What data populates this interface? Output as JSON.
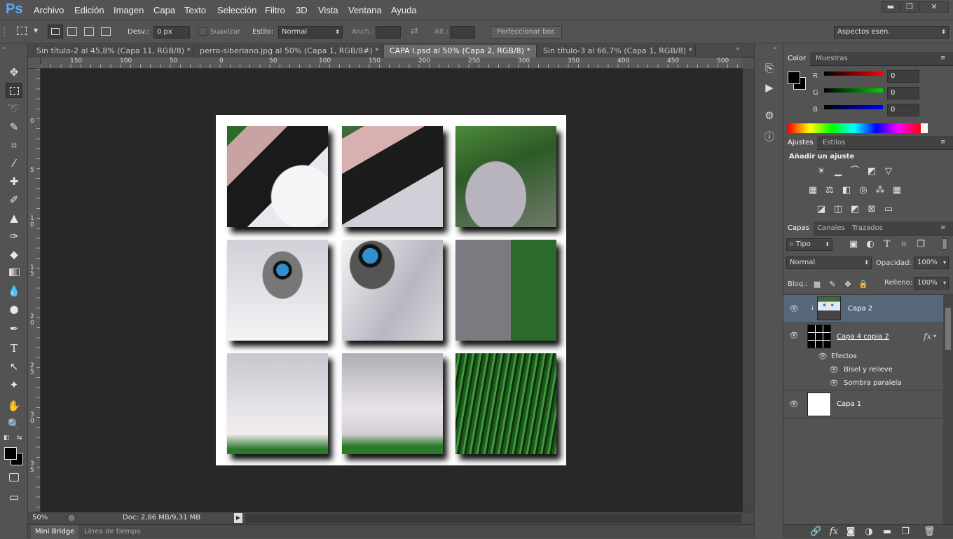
{
  "app": {
    "logo": "Ps"
  },
  "menu": [
    "Archivo",
    "Edición",
    "Imagen",
    "Capa",
    "Texto",
    "Selección",
    "Filtro",
    "3D",
    "Vista",
    "Ventana",
    "Ayuda"
  ],
  "window_controls": {
    "minimize": "▬",
    "restore": "❐",
    "close": "✕"
  },
  "options": {
    "feather_label": "Desv.:",
    "feather_value": "0 px",
    "antialias_label": "Suavizar",
    "style_label": "Estilo:",
    "style_value": "Normal",
    "width_label": "Anch.:",
    "height_label": "Alt.:",
    "refine_button": "Perfeccionar bor.",
    "workspace": "Aspectos esen."
  },
  "tabs": [
    {
      "label": "Sin título-2 al 45,8% (Capa 11, RGB/8) *",
      "active": false
    },
    {
      "label": "perro-siberiano.jpg al 50% (Capa 1, RGB/8#) *",
      "active": false
    },
    {
      "label": "CAPA I.psd al 50% (Capa 2, RGB/8) *",
      "active": true
    },
    {
      "label": "Sin título-3 al 66,7% (Capa 1, RGB/8) *",
      "active": false
    }
  ],
  "ruler_h": [
    "150",
    "100",
    "50",
    "0",
    "50",
    "100",
    "150",
    "200",
    "250",
    "300",
    "350",
    "400",
    "450",
    "500"
  ],
  "ruler_v": [
    "0",
    "5",
    "1 0",
    "1 5",
    "2 0",
    "2 5",
    "3 0",
    "3 5"
  ],
  "status": {
    "zoom": "50%",
    "doc": "Doc: 2,86 MB/9,31 MB"
  },
  "bottom_tabs": [
    "Mini Bridge",
    "Línea de tiempo"
  ],
  "color_panel": {
    "tabs": [
      "Color",
      "Muestras"
    ],
    "channels": [
      {
        "label": "R",
        "value": "0"
      },
      {
        "label": "G",
        "value": "0"
      },
      {
        "label": "B",
        "value": "0"
      }
    ],
    "colors": {
      "red": "#ff0000",
      "green": "#00c000",
      "blue": "#0000ff"
    }
  },
  "adjust_panel": {
    "tabs": [
      "Ajustes",
      "Estilos"
    ],
    "title": "Añadir un ajuste"
  },
  "layers_panel": {
    "tabs": [
      "Capas",
      "Canales",
      "Trazados"
    ],
    "filter": "Tipo",
    "blend": "Normal",
    "opacity_label": "Opacidad:",
    "opacity": "100%",
    "lock_label": "Bloq.:",
    "fill_label": "Relleno:",
    "fill": "100%",
    "layers": [
      {
        "name": "Capa 2",
        "selected": true
      },
      {
        "name": "Capa 4 copia 2",
        "fx": "fx",
        "selected": false
      },
      {
        "name": "Capa 1",
        "selected": false
      }
    ],
    "effects_label": "Efectos",
    "effects": [
      "Bisel y relieve",
      "Sombra paralela"
    ]
  }
}
